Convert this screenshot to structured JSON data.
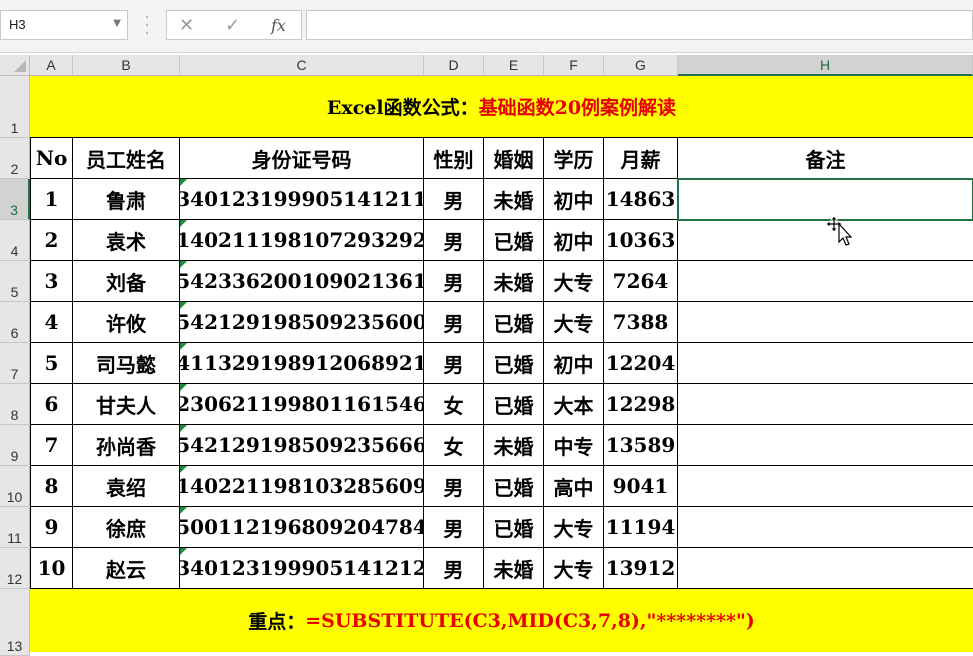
{
  "formula_bar": {
    "name_box": "H3",
    "cancel_icon": "✕",
    "enter_icon": "✓",
    "fx_label": "fx",
    "formula_value": ""
  },
  "columns": [
    "A",
    "B",
    "C",
    "D",
    "E",
    "F",
    "G",
    "H"
  ],
  "rows": [
    "1",
    "2",
    "3",
    "4",
    "5",
    "6",
    "7",
    "8",
    "9",
    "10",
    "11",
    "12",
    "13"
  ],
  "active_cell": "H3",
  "title_banner": {
    "part1": "Excel函数公式：",
    "part2": "基础函数20例案例解读"
  },
  "headers": [
    "No",
    "员工姓名",
    "身份证号码",
    "性别",
    "婚姻",
    "学历",
    "月薪",
    "备注"
  ],
  "records": [
    {
      "no": "1",
      "name": "鲁肃",
      "id": "340123199905141211",
      "gender": "男",
      "marital": "未婚",
      "edu": "初中",
      "salary": "14863",
      "note": ""
    },
    {
      "no": "2",
      "name": "袁术",
      "id": "140211198107293292",
      "gender": "男",
      "marital": "已婚",
      "edu": "初中",
      "salary": "10363",
      "note": ""
    },
    {
      "no": "3",
      "name": "刘备",
      "id": "542336200109021361",
      "gender": "男",
      "marital": "未婚",
      "edu": "大专",
      "salary": "7264",
      "note": ""
    },
    {
      "no": "4",
      "name": "许攸",
      "id": "542129198509235600",
      "gender": "男",
      "marital": "已婚",
      "edu": "大专",
      "salary": "7388",
      "note": ""
    },
    {
      "no": "5",
      "name": "司马懿",
      "id": "411329198912068921",
      "gender": "男",
      "marital": "已婚",
      "edu": "初中",
      "salary": "12204",
      "note": ""
    },
    {
      "no": "6",
      "name": "甘夫人",
      "id": "230621199801161546",
      "gender": "女",
      "marital": "已婚",
      "edu": "大本",
      "salary": "12298",
      "note": ""
    },
    {
      "no": "7",
      "name": "孙尚香",
      "id": "542129198509235666",
      "gender": "女",
      "marital": "未婚",
      "edu": "中专",
      "salary": "13589",
      "note": ""
    },
    {
      "no": "8",
      "name": "袁绍",
      "id": "140221198103285609",
      "gender": "男",
      "marital": "已婚",
      "edu": "高中",
      "salary": "9041",
      "note": ""
    },
    {
      "no": "9",
      "name": "徐庶",
      "id": "500112196809204784",
      "gender": "男",
      "marital": "已婚",
      "edu": "大专",
      "salary": "11194",
      "note": ""
    },
    {
      "no": "10",
      "name": "赵云",
      "id": "340123199905141212",
      "gender": "男",
      "marital": "未婚",
      "edu": "大专",
      "salary": "13912",
      "note": ""
    }
  ],
  "footer_banner": {
    "part1": "重点：",
    "part2": "=SUBSTITUTE(C3,MID(C3,7,8),\"********\")"
  },
  "colors": {
    "banner_bg": "#ffff00",
    "accent_red": "#e60000",
    "excel_green": "#217346"
  }
}
